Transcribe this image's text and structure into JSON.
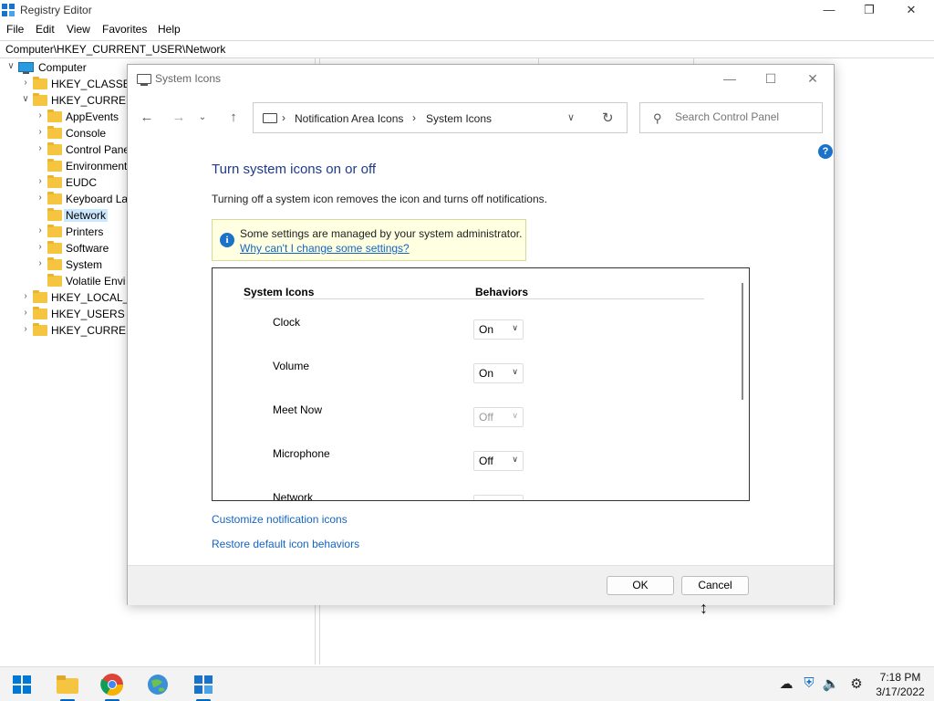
{
  "regedit": {
    "title": "Registry Editor",
    "menu": [
      "File",
      "Edit",
      "View",
      "Favorites",
      "Help"
    ],
    "address": "Computer\\HKEY_CURRENT_USER\\Network",
    "tree": [
      {
        "label": "Computer",
        "chev": "∨"
      },
      {
        "label": "HKEY_CLASSES_",
        "chev": "›"
      },
      {
        "label": "HKEY_CURRENT",
        "chev": "∨"
      },
      {
        "label": "AppEvents",
        "chev": "›"
      },
      {
        "label": "Console",
        "chev": "›"
      },
      {
        "label": "Control Pane",
        "chev": "›"
      },
      {
        "label": "Environment",
        "chev": ""
      },
      {
        "label": "EUDC",
        "chev": "›"
      },
      {
        "label": "Keyboard La",
        "chev": "›"
      },
      {
        "label": "Network",
        "chev": ""
      },
      {
        "label": "Printers",
        "chev": "›"
      },
      {
        "label": "Software",
        "chev": "›"
      },
      {
        "label": "System",
        "chev": "›"
      },
      {
        "label": "Volatile Envi",
        "chev": ""
      },
      {
        "label": "HKEY_LOCAL_M",
        "chev": "›"
      },
      {
        "label": "HKEY_USERS",
        "chev": "›"
      },
      {
        "label": "HKEY_CURRENT",
        "chev": "›"
      }
    ]
  },
  "dialog": {
    "title": "System Icons",
    "breadcrumb": [
      "Notification Area Icons",
      "System Icons"
    ],
    "search_placeholder": "Search Control Panel",
    "heading": "Turn system icons on or off",
    "description": "Turning off a system icon removes the icon and turns off notifications.",
    "info_text": "Some settings are managed by your system administrator.",
    "info_link": "Why can't I change some settings?",
    "columns": {
      "icons": "System Icons",
      "behaviors": "Behaviors"
    },
    "icons": [
      {
        "name": "Clock",
        "behavior": "On",
        "disabled": false
      },
      {
        "name": "Volume",
        "behavior": "On",
        "disabled": false
      },
      {
        "name": "Meet Now",
        "behavior": "Off",
        "disabled": true
      },
      {
        "name": "Microphone",
        "behavior": "Off",
        "disabled": false
      },
      {
        "name": "Network",
        "behavior": "",
        "disabled": false
      }
    ],
    "customize_link": "Customize notification icons",
    "restore_link": "Restore default icon behaviors",
    "ok_label": "OK",
    "cancel_label": "Cancel"
  },
  "taskbar": {
    "apps": [
      "windows-start",
      "file-explorer",
      "chrome",
      "network-app",
      "registry-editor"
    ],
    "time": "7:18 PM",
    "date": "3/17/2022"
  },
  "colors": {
    "accent": "#0078d4",
    "link": "#1565c0",
    "heading": "#1e3a8a",
    "info_bg": "#ffffe1",
    "folder": "#f5c542"
  }
}
